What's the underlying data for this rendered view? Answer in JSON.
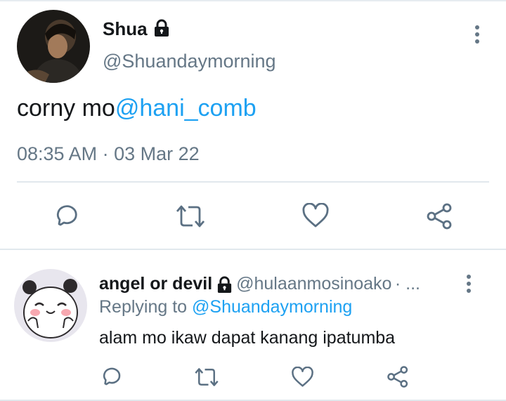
{
  "tweet": {
    "author_name": "Shua",
    "author_handle": "@Shuandaymorning",
    "text": "corny mo",
    "mention": "@hani_comb",
    "time": "08:35 AM",
    "separator": "·",
    "date": "03 Mar 22",
    "avatar_icon": "profile-photo"
  },
  "reply": {
    "author_name": "angel or devil",
    "author_handle": "@hulaanmosinoako",
    "handle_suffix": "· ...",
    "replying_prefix": "Replying to",
    "replying_handle": "@Shuandaymorning",
    "text": "alam mo ikaw dapat kanang ipatumba",
    "avatar_icon": "panda-bear-avatar"
  },
  "icons": [
    "lock-icon",
    "more-vertical-icon",
    "reply-icon",
    "retweet-icon",
    "like-icon",
    "share-icon"
  ],
  "colors": {
    "link": "#1da1f2",
    "secondary": "#657786",
    "icon": "#5b7083"
  }
}
